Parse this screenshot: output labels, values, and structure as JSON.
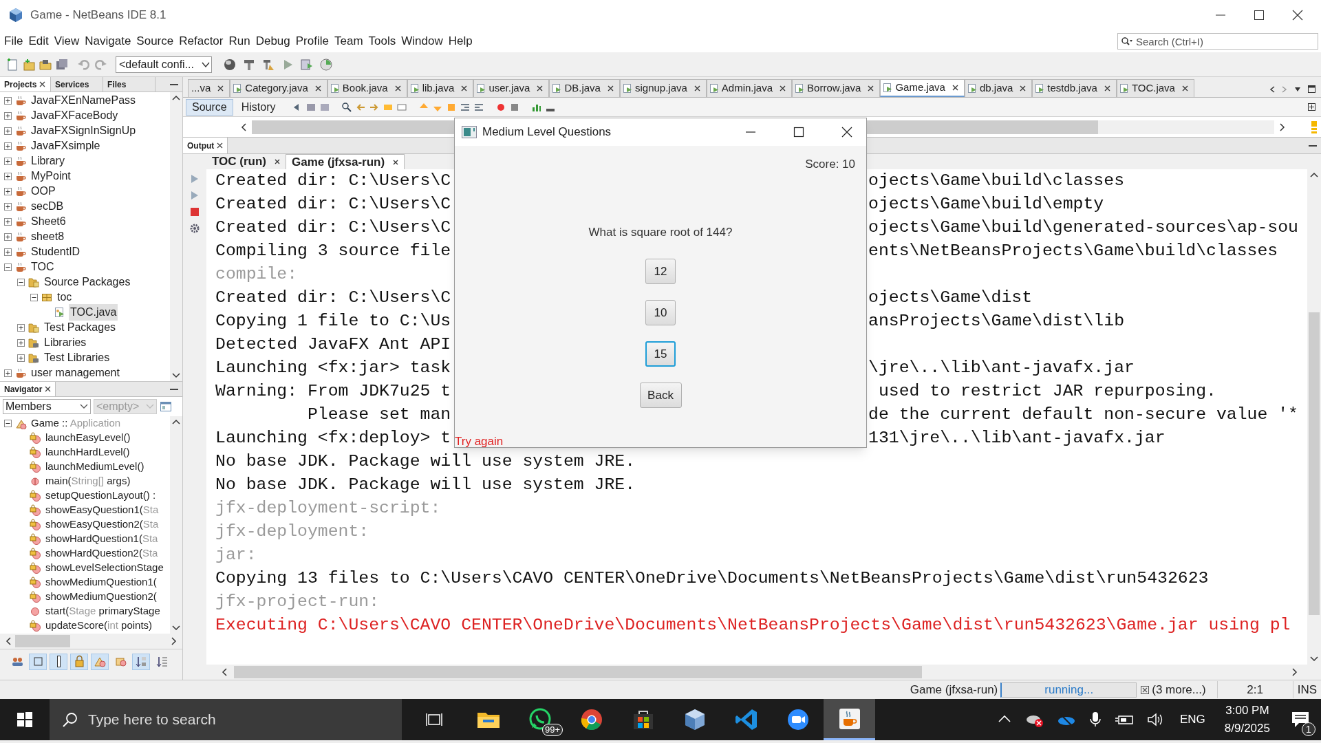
{
  "window": {
    "title": "Game - NetBeans IDE 8.1"
  },
  "menu": [
    "File",
    "Edit",
    "View",
    "Navigate",
    "Source",
    "Refactor",
    "Run",
    "Debug",
    "Profile",
    "Team",
    "Tools",
    "Window",
    "Help"
  ],
  "search": {
    "placeholder": "Search (Ctrl+I)"
  },
  "toolbar": {
    "config": "<default confi..."
  },
  "side_tabs": [
    {
      "label": "Projects",
      "selected": true
    },
    {
      "label": "Services",
      "selected": false
    },
    {
      "label": "Files",
      "selected": false
    }
  ],
  "projects": [
    {
      "kind": "project",
      "label": "JavaFXEnNamePass",
      "expanded": false,
      "selected": false
    },
    {
      "kind": "project",
      "label": "JavaFXFaceBody",
      "expanded": false,
      "selected": false
    },
    {
      "kind": "project",
      "label": "JavaFXSignInSignUp",
      "expanded": false,
      "selected": false
    },
    {
      "kind": "project",
      "label": "JavaFXsimple",
      "expanded": false,
      "selected": false
    },
    {
      "kind": "project",
      "label": "Library",
      "expanded": false,
      "selected": false
    },
    {
      "kind": "project",
      "label": "MyPoint",
      "expanded": false,
      "selected": false
    },
    {
      "kind": "project",
      "label": "OOP",
      "expanded": false,
      "selected": false
    },
    {
      "kind": "project",
      "label": "secDB",
      "expanded": false,
      "selected": false
    },
    {
      "kind": "project",
      "label": "Sheet6",
      "expanded": false,
      "selected": false
    },
    {
      "kind": "project",
      "label": "sheet8",
      "expanded": false,
      "selected": false
    },
    {
      "kind": "project",
      "label": "StudentID",
      "expanded": false,
      "selected": false
    },
    {
      "kind": "project",
      "label": "TOC",
      "expanded": true,
      "selected": false,
      "children": [
        {
          "kind": "folder",
          "label": "Source Packages",
          "expanded": true,
          "selected": false,
          "children": [
            {
              "kind": "package",
              "label": "toc",
              "expanded": true,
              "selected": false,
              "children": [
                {
                  "kind": "file",
                  "label": "TOC.java",
                  "selected": true
                }
              ]
            }
          ]
        },
        {
          "kind": "folder",
          "label": "Test Packages",
          "expanded": false,
          "selected": false
        },
        {
          "kind": "library",
          "label": "Libraries",
          "expanded": false,
          "selected": false
        },
        {
          "kind": "library",
          "label": "Test Libraries",
          "expanded": false,
          "selected": false
        }
      ]
    },
    {
      "kind": "project",
      "label": "user management",
      "expanded": false,
      "selected": false
    }
  ],
  "navigator": {
    "title": "Navigator",
    "filter": "Members",
    "subfilter": "<empty>",
    "root": {
      "kind": "class",
      "expanded": true,
      "segments": [
        {
          "text": "Game :: ",
          "muted": false
        },
        {
          "text": "Application",
          "muted": true
        }
      ]
    },
    "members": [
      {
        "kind": "private",
        "segments": [
          {
            "text": "launchEasyLevel()",
            "muted": false
          }
        ]
      },
      {
        "kind": "private",
        "segments": [
          {
            "text": "launchHardLevel()",
            "muted": false
          }
        ]
      },
      {
        "kind": "private",
        "segments": [
          {
            "text": "launchMediumLevel()",
            "muted": false
          }
        ]
      },
      {
        "kind": "static",
        "segments": [
          {
            "text": "main(",
            "muted": false
          },
          {
            "text": "String[]",
            "muted": true
          },
          {
            "text": " args)",
            "muted": false
          }
        ]
      },
      {
        "kind": "private",
        "segments": [
          {
            "text": "setupQuestionLayout() :",
            "muted": false
          }
        ]
      },
      {
        "kind": "private",
        "segments": [
          {
            "text": "showEasyQuestion1(",
            "muted": false
          },
          {
            "text": "Sta",
            "muted": true
          }
        ]
      },
      {
        "kind": "private",
        "segments": [
          {
            "text": "showEasyQuestion2(",
            "muted": false
          },
          {
            "text": "Sta",
            "muted": true
          }
        ]
      },
      {
        "kind": "private",
        "segments": [
          {
            "text": "showHardQuestion1(",
            "muted": false
          },
          {
            "text": "Sta",
            "muted": true
          }
        ]
      },
      {
        "kind": "private",
        "segments": [
          {
            "text": "showHardQuestion2(",
            "muted": false
          },
          {
            "text": "Sta",
            "muted": true
          }
        ]
      },
      {
        "kind": "private",
        "segments": [
          {
            "text": "showLevelSelectionStage",
            "muted": false
          }
        ]
      },
      {
        "kind": "private",
        "segments": [
          {
            "text": "showMediumQuestion1(",
            "muted": false
          }
        ]
      },
      {
        "kind": "private",
        "segments": [
          {
            "text": "showMediumQuestion2(",
            "muted": false
          }
        ]
      },
      {
        "kind": "public",
        "segments": [
          {
            "text": "start(",
            "muted": false
          },
          {
            "text": "Stage",
            "muted": true
          },
          {
            "text": " primaryStage",
            "muted": false
          }
        ]
      },
      {
        "kind": "private",
        "segments": [
          {
            "text": "updateScore(",
            "muted": false
          },
          {
            "text": "int",
            "muted": true
          },
          {
            "text": " points)",
            "muted": false
          }
        ]
      }
    ],
    "filter_buttons": [
      {
        "on": false
      },
      {
        "on": true
      },
      {
        "on": true
      },
      {
        "on": true
      },
      {
        "on": true
      },
      {
        "on": false
      },
      {
        "on": true
      },
      {
        "on": false
      }
    ]
  },
  "editor_tabs": [
    {
      "label": "...va",
      "selected": false
    },
    {
      "label": "Category.java",
      "selected": false
    },
    {
      "label": "Book.java",
      "selected": false
    },
    {
      "label": "lib.java",
      "selected": false
    },
    {
      "label": "user.java",
      "selected": false
    },
    {
      "label": "DB.java",
      "selected": false
    },
    {
      "label": "signup.java",
      "selected": false
    },
    {
      "label": "Admin.java",
      "selected": false
    },
    {
      "label": "Borrow.java",
      "selected": false
    },
    {
      "label": "Game.java",
      "selected": true
    },
    {
      "label": "db.java",
      "selected": false
    },
    {
      "label": "testdb.java",
      "selected": false
    },
    {
      "label": "TOC.java",
      "selected": false
    }
  ],
  "editor_views": [
    {
      "label": "Source",
      "selected": true
    },
    {
      "label": "History",
      "selected": false
    }
  ],
  "output": {
    "title": "Output",
    "tabs": [
      {
        "label": "TOC (run)",
        "selected": false
      },
      {
        "label": "Game (jfxsa-run)",
        "selected": true
      }
    ],
    "lines": [
      {
        "kind": "info",
        "left": "Created dir: C:\\Users\\C",
        "right": "ojects\\Game\\build\\classes"
      },
      {
        "kind": "info",
        "left": "Created dir: C:\\Users\\C",
        "right": "ojects\\Game\\build\\empty"
      },
      {
        "kind": "info",
        "left": "Created dir: C:\\Users\\C",
        "right": "ojects\\Game\\build\\generated-sources\\ap-sou"
      },
      {
        "kind": "info",
        "left": "Compiling 3 source file",
        "right": "ents\\NetBeansProjects\\Game\\build\\classes"
      },
      {
        "kind": "target",
        "left": "compile:"
      },
      {
        "kind": "info",
        "left": "Created dir: C:\\Users\\C",
        "right": "ojects\\Game\\dist"
      },
      {
        "kind": "info",
        "left": "Copying 1 file to C:\\Us",
        "right": "ansProjects\\Game\\dist\\lib"
      },
      {
        "kind": "info",
        "left": "Detected JavaFX Ant API"
      },
      {
        "kind": "info",
        "left": "Launching <fx:jar> task",
        "right": "\\jre\\..\\lib\\ant-javafx.jar"
      },
      {
        "kind": "info",
        "left": "Warning: From JDK7u25 t",
        "right": " used to restrict JAR repurposing."
      },
      {
        "kind": "info",
        "left": "         Please set man",
        "right": "de the current default non-secure value '*"
      },
      {
        "kind": "info",
        "left": "Launching <fx:deploy> t",
        "right": "131\\jre\\..\\lib\\ant-javafx.jar"
      },
      {
        "kind": "info",
        "text": "No base JDK. Package will use system JRE."
      },
      {
        "kind": "info",
        "text": "No base JDK. Package will use system JRE."
      },
      {
        "kind": "target",
        "text": "jfx-deployment-script:"
      },
      {
        "kind": "target",
        "text": "jfx-deployment:"
      },
      {
        "kind": "target",
        "text": "jar:"
      },
      {
        "kind": "info",
        "text": "Copying 13 files to C:\\Users\\CAVO CENTER\\OneDrive\\Documents\\NetBeansProjects\\Game\\dist\\run5432623"
      },
      {
        "kind": "target",
        "text": "jfx-project-run:"
      },
      {
        "kind": "error",
        "text": "Executing C:\\Users\\CAVO CENTER\\OneDrive\\Documents\\NetBeansProjects\\Game\\dist\\run5432623\\Game.jar using pl"
      }
    ]
  },
  "dialog": {
    "title": "Medium Level Questions",
    "score": "Score: 10",
    "question": "What is square root of 144?",
    "answers": [
      {
        "label": "12",
        "focused": false
      },
      {
        "label": "10",
        "focused": false
      },
      {
        "label": "15",
        "focused": true
      }
    ],
    "back": "Back",
    "message": "Try again"
  },
  "status_bar": {
    "task": "Game (jfxsa-run)",
    "progress": "running...",
    "more": "(3 more...)",
    "position": "2:1",
    "mode": "INS"
  },
  "taskbar": {
    "search_placeholder": "Type here to search",
    "apps": [
      {
        "kind": "explorer",
        "active": false
      },
      {
        "kind": "whatsapp",
        "active": false,
        "badge": "99+"
      },
      {
        "kind": "chrome",
        "active": false
      },
      {
        "kind": "store",
        "active": false
      },
      {
        "kind": "box",
        "active": false
      },
      {
        "kind": "vscode",
        "active": false
      },
      {
        "kind": "zoom",
        "active": false
      },
      {
        "kind": "java",
        "active": true
      }
    ],
    "language": "ENG",
    "time": "3:00 PM",
    "date": "8/9/2025",
    "notifications": "1"
  }
}
